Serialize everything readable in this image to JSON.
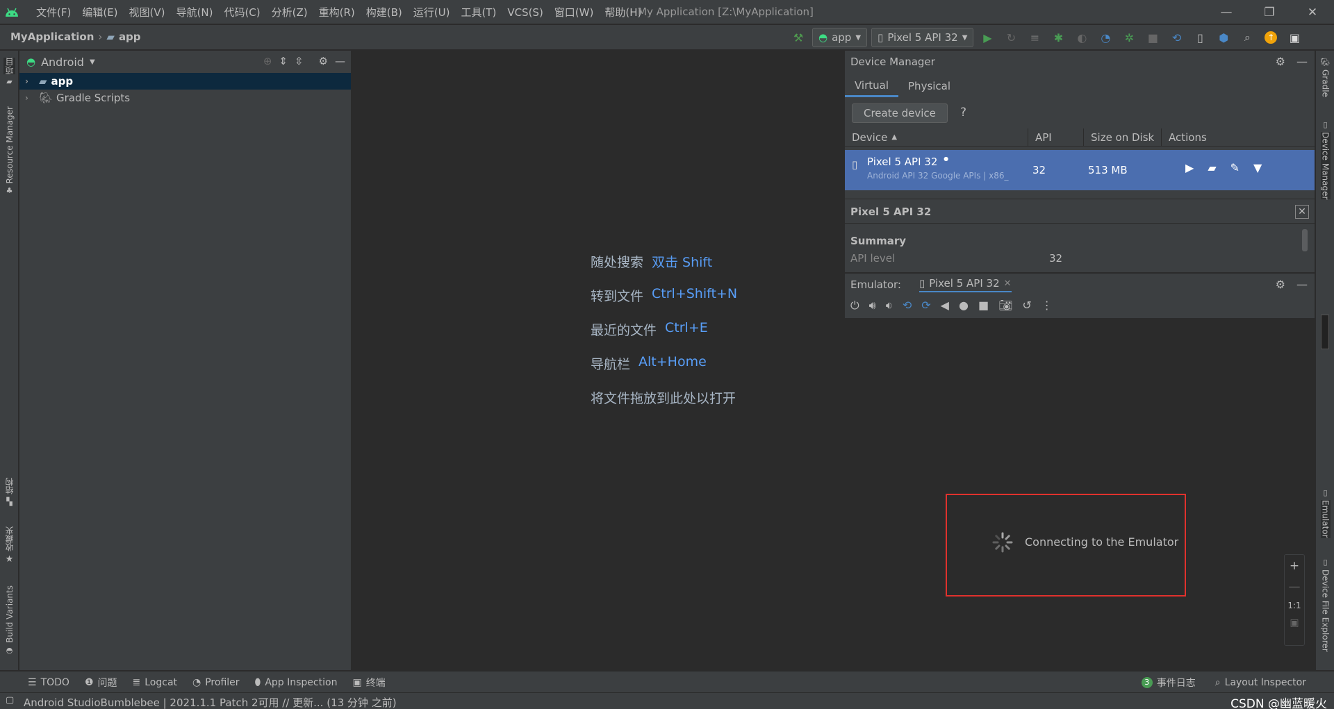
{
  "menubar": {
    "items": [
      "文件(F)",
      "编辑(E)",
      "视图(V)",
      "导航(N)",
      "代码(C)",
      "分析(Z)",
      "重构(R)",
      "构建(B)",
      "运行(U)",
      "工具(T)",
      "VCS(S)",
      "窗口(W)",
      "帮助(H)"
    ],
    "window_title": "My Application [Z:\\MyApplication]"
  },
  "navbar": {
    "project": "MyApplication",
    "module": "app",
    "run_config": "app",
    "device": "Pixel 5 API 32"
  },
  "left_stripe": {
    "project": "项目",
    "resource_manager": "Resource Manager",
    "structure": "结构",
    "favorites": "收藏夹",
    "build_variants": "Build Variants"
  },
  "right_stripe": {
    "gradle": "Gradle",
    "device_manager": "Device Manager",
    "emulator": "Emulator",
    "device_file_explorer": "Device File Explorer"
  },
  "project_panel": {
    "view": "Android",
    "tree": [
      {
        "label": "app"
      },
      {
        "label": "Gradle Scripts"
      }
    ]
  },
  "editor_hints": [
    {
      "text": "随处搜索",
      "key": "双击 Shift"
    },
    {
      "text": "转到文件",
      "key": "Ctrl+Shift+N"
    },
    {
      "text": "最近的文件",
      "key": "Ctrl+E"
    },
    {
      "text": "导航栏",
      "key": "Alt+Home"
    },
    {
      "text": "将文件拖放到此处以打开",
      "key": ""
    }
  ],
  "device_manager": {
    "title": "Device Manager",
    "tabs": [
      "Virtual",
      "Physical"
    ],
    "create_button": "Create device",
    "help": "?",
    "columns": [
      "Device",
      "API",
      "Size on Disk",
      "Actions"
    ],
    "device": {
      "name": "Pixel 5 API 32",
      "subtitle": "Android API 32 Google APIs | x86_",
      "api": "32",
      "size": "513 MB"
    },
    "details": {
      "title": "Pixel 5 API 32",
      "summary_label": "Summary",
      "api_level_label": "API level",
      "api_level_value": "32"
    }
  },
  "emulator": {
    "label": "Emulator:",
    "tab": "Pixel 5 API 32",
    "status": "Connecting to the Emulator",
    "zoom_actual": "1:1"
  },
  "bottom_tools": {
    "left": [
      "TODO",
      "问题",
      "Logcat",
      "Profiler",
      "App Inspection",
      "终端"
    ],
    "event_count": "3",
    "event_log": "事件日志",
    "layout_inspector": "Layout Inspector"
  },
  "status": {
    "message": "Android StudioBumblebee | 2021.1.1 Patch 2可用 // 更新... (13 分钟 之前)",
    "watermark": "CSDN @幽蓝暖火"
  },
  "colors": {
    "accent": "#4a88c7",
    "selection_row": "#4b6eaf",
    "highlight_box": "#e0312d",
    "android_green": "#3ddc84"
  }
}
